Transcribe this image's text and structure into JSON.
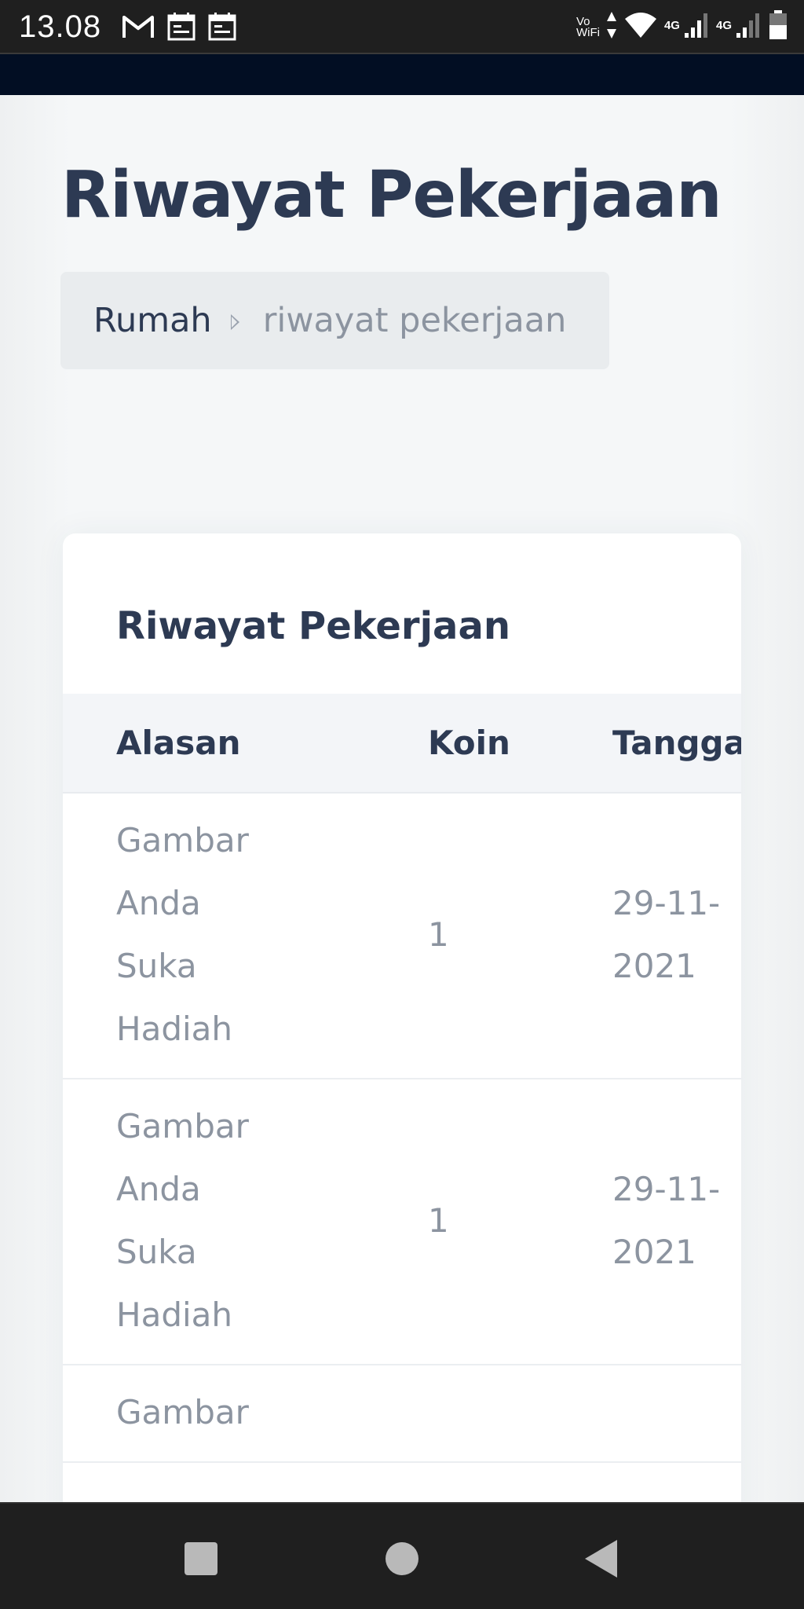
{
  "status_bar": {
    "time": "13.08",
    "vowifi_line1": "Vo",
    "vowifi_line2": "WiFi",
    "network_1": "4G",
    "network_2": "4G",
    "icons_left": [
      "gmail-icon",
      "calendar-icon",
      "calendar-icon"
    ],
    "icons_right": [
      "vowifi-icon",
      "data-arrows-icon",
      "wifi-icon",
      "signal-icon",
      "signal-icon",
      "battery-icon"
    ]
  },
  "header": {
    "title": "Riwayat Pekerjaan"
  },
  "breadcrumb": {
    "home": "Rumah",
    "current": "riwayat pekerjaan"
  },
  "card": {
    "title": "Riwayat Pekerjaan",
    "columns": [
      "Alasan",
      "Koin",
      "Tanggal"
    ],
    "rows": [
      {
        "reason": "Gambar Anda Suka Hadiah",
        "coins": "1",
        "date": "29-11-2021"
      },
      {
        "reason": "Gambar Anda Suka Hadiah",
        "coins": "1",
        "date": "29-11-2021"
      },
      {
        "reason": "Gambar",
        "coins": "",
        "date": ""
      }
    ]
  },
  "nav_bar": {
    "buttons": [
      "recents-square-icon",
      "home-circle-icon",
      "back-triangle-icon"
    ]
  },
  "colors": {
    "title": "#2d3a53",
    "muted_text": "#8c94a0",
    "header_strip": "#020e23",
    "system_bar": "#1f1f1f",
    "table_head_bg": "#f3f5f8",
    "breadcrumb_bg": "#e9ecee"
  }
}
